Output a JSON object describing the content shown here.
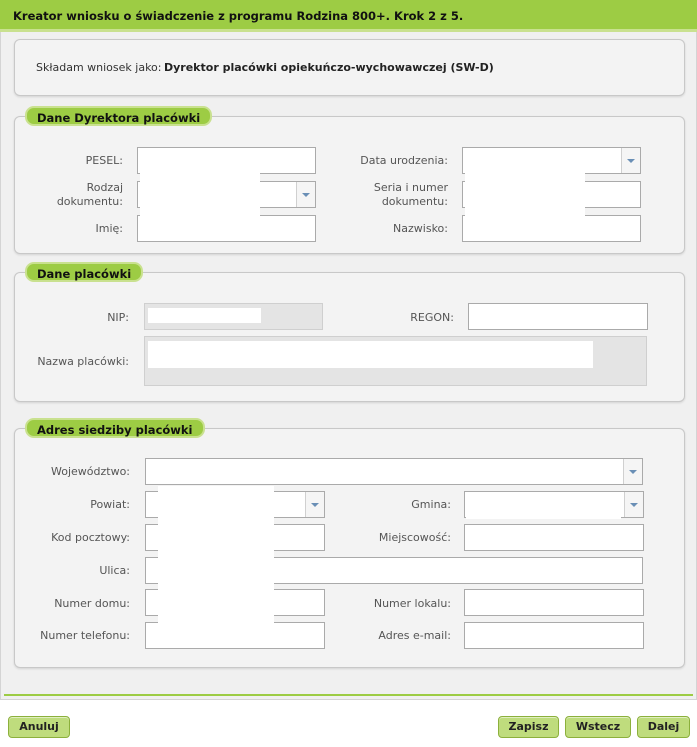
{
  "title": "Kreator wniosku o świadczenie z programu Rodzina 800+. Krok 2 z 5.",
  "applicant": {
    "label": "Składam wniosek jako:",
    "value": "Dyrektor placówki opiekuńczo-wychowawczej (SW-D)"
  },
  "director": {
    "legend": "Dane Dyrektora placówki",
    "pesel_label": "PESEL:",
    "birthdate_label": "Data urodzenia:",
    "doctype_label_1": "Rodzaj",
    "doctype_label_2": "dokumentu:",
    "docnumber_label_1": "Seria i numer",
    "docnumber_label_2": "dokumentu:",
    "firstname_label": "Imię:",
    "lastname_label": "Nazwisko:"
  },
  "institution": {
    "legend": "Dane placówki",
    "nip_label": "NIP:",
    "regon_label": "REGON:",
    "name_label": "Nazwa placówki:"
  },
  "address": {
    "legend": "Adres siedziby placówki",
    "voivodeship_label": "Województwo:",
    "county_label": "Powiat:",
    "commune_label": "Gmina:",
    "postcode_label": "Kod pocztowy:",
    "city_label": "Miejscowość:",
    "street_label": "Ulica:",
    "house_label": "Numer domu:",
    "apartment_label": "Numer lokalu:",
    "phone_label": "Numer telefonu:",
    "email_label": "Adres e-mail:"
  },
  "buttons": {
    "cancel": "Anuluj",
    "save": "Zapisz",
    "back": "Wstecz",
    "next": "Dalej"
  },
  "colors": {
    "accent": "#9dcc44",
    "accent_light": "#c9e18f",
    "button": "#bfdc7d"
  }
}
